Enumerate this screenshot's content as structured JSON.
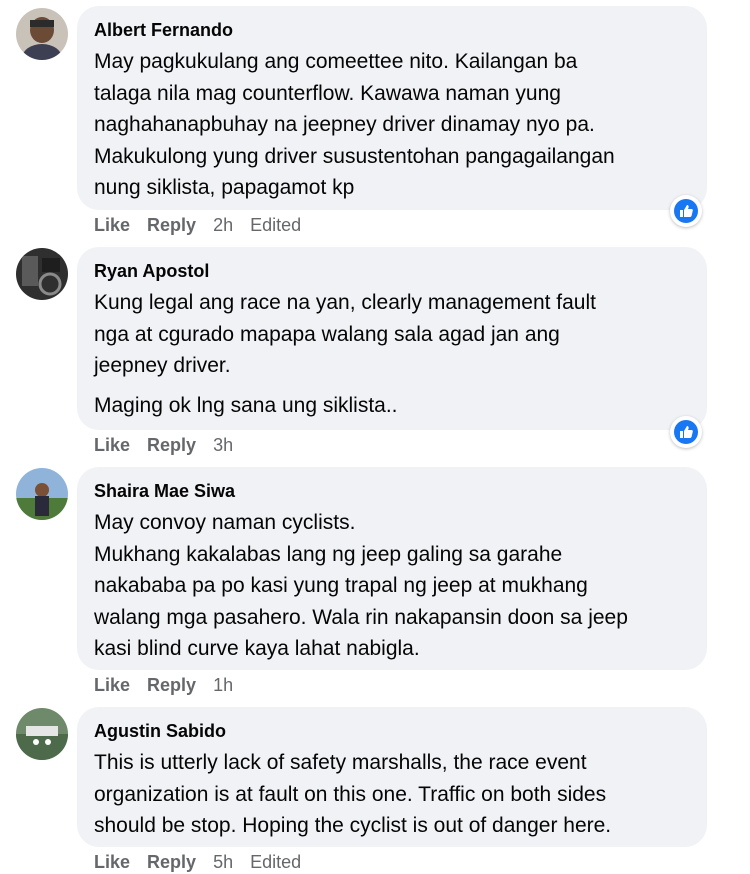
{
  "comments": [
    {
      "author": "Albert Fernando",
      "lines": [
        "May pagkukulang ang comeettee nito. Kailangan ba",
        "talaga nila mag counterflow. Kawawa naman yung",
        "naghahanapbuhay na jeepney driver dinamay nyo pa.",
        "Makukulong yung driver susustentohan pangagailangan",
        "nung siklista, papagamot kp"
      ],
      "extra_lines": [],
      "like_label": "Like",
      "reply_label": "Reply",
      "time": "2h",
      "edited": "Edited",
      "reaction_icon": "like-icon",
      "avatar_color": "#6b4a36"
    },
    {
      "author": "Ryan Apostol",
      "lines": [
        "Kung legal ang race na yan, clearly management fault",
        "nga at cgurado mapapa walang sala agad jan ang",
        "jeepney driver."
      ],
      "extra_lines": [
        "Maging ok lng sana ung siklista.."
      ],
      "like_label": "Like",
      "reply_label": "Reply",
      "time": "3h",
      "edited": "",
      "reaction_icon": "like-icon",
      "avatar_color": "#3c3c3c"
    },
    {
      "author": "Shaira Mae Siwa",
      "lines": [
        "May convoy naman cyclists.",
        "Mukhang kakalabas lang ng jeep galing sa garahe",
        "nakababa pa po kasi yung trapal ng jeep at mukhang",
        "walang mga pasahero. Wala rin nakapansin doon sa jeep",
        "kasi blind curve kaya lahat nabigla."
      ],
      "extra_lines": [],
      "like_label": "Like",
      "reply_label": "Reply",
      "time": "1h",
      "edited": "",
      "reaction_icon": "",
      "avatar_color": "#8fb3d9"
    },
    {
      "author": "Agustin Sabido",
      "lines": [
        "This is utterly lack of safety marshalls, the race event",
        "organization is at fault on this one. Traffic on both sides",
        "should be stop. Hoping the cyclist is out of danger here."
      ],
      "extra_lines": [],
      "like_label": "Like",
      "reply_label": "Reply",
      "time": "5h",
      "edited": "Edited",
      "reaction_icon": "",
      "avatar_color": "#4d6b4a"
    }
  ],
  "colors": {
    "bubble": "#f0f2f5",
    "secondary_text": "#65676b",
    "like_blue": "#1877f2"
  }
}
